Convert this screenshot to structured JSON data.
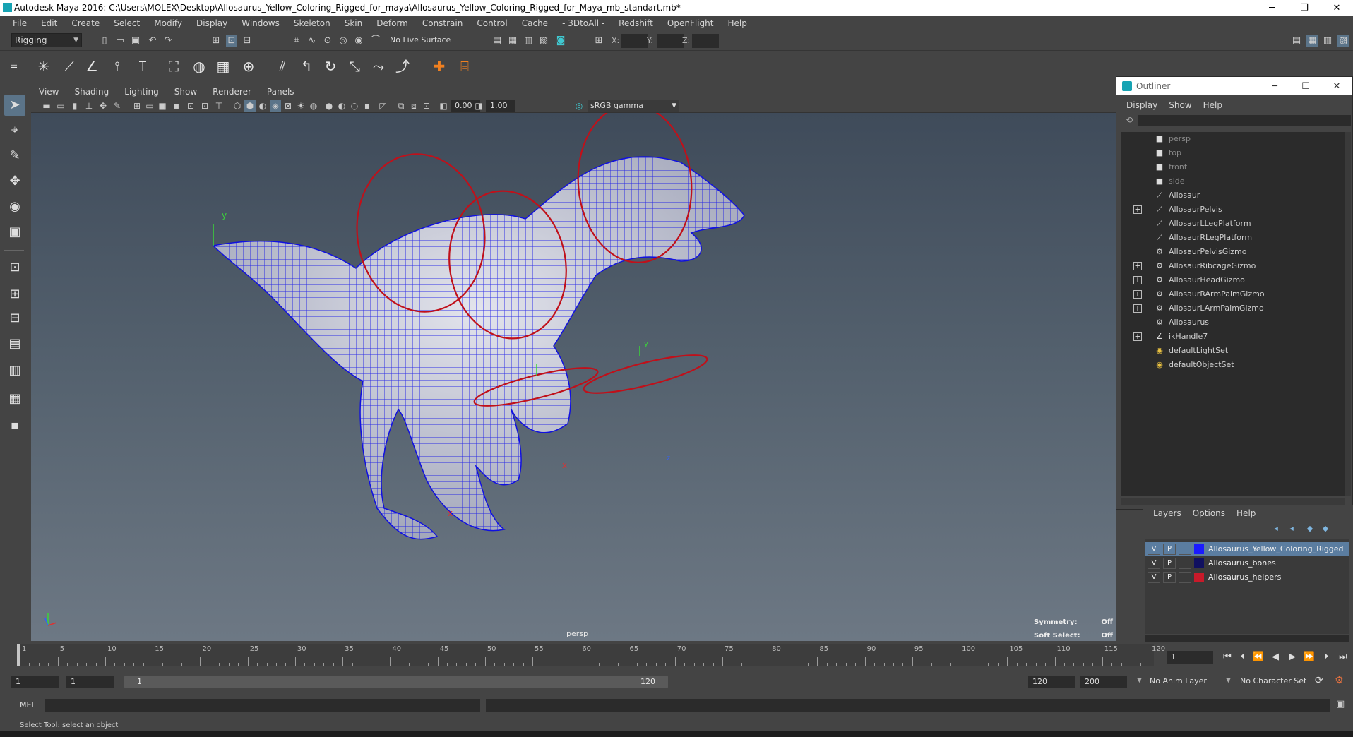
{
  "window": {
    "title": "Autodesk Maya 2016: C:\\Users\\MOLEX\\Desktop\\Allosaurus_Yellow_Coloring_Rigged_for_maya\\Allosaurus_Yellow_Coloring_Rigged_for_Maya_mb_standart.mb*",
    "minimize": "─",
    "restore": "❐",
    "close": "✕"
  },
  "menubar": [
    "File",
    "Edit",
    "Create",
    "Select",
    "Modify",
    "Display",
    "Windows",
    "Skeleton",
    "Skin",
    "Deform",
    "Constrain",
    "Control",
    "Cache",
    "- 3DtoAll -",
    "Redshift",
    "OpenFlight",
    "Help"
  ],
  "statusline": {
    "mode": "Rigging",
    "live_surface": "No Live Surface",
    "x_label": "X:",
    "y_label": "Y:",
    "z_label": "Z:"
  },
  "viewport": {
    "menu": [
      "View",
      "Shading",
      "Lighting",
      "Show",
      "Renderer",
      "Panels"
    ],
    "exposure": "0.00",
    "gamma_value": "1.00",
    "color_space": "sRGB gamma",
    "camera": "persp",
    "symmetry_label": "Symmetry:",
    "symmetry_value": "Off",
    "soft_select_label": "Soft Select:",
    "soft_select_value": "Off",
    "axis_y": "y",
    "axis_x": "x",
    "axis_z": "z"
  },
  "outliner": {
    "title": "Outliner",
    "menu": [
      "Display",
      "Show",
      "Help"
    ],
    "items": [
      {
        "label": "persp",
        "icon": "camera-icon",
        "expand": "",
        "dim": true
      },
      {
        "label": "top",
        "icon": "camera-icon",
        "expand": "",
        "dim": true
      },
      {
        "label": "front",
        "icon": "camera-icon",
        "expand": "",
        "dim": true
      },
      {
        "label": "side",
        "icon": "camera-icon",
        "expand": "",
        "dim": true
      },
      {
        "label": "Allosaur",
        "icon": "joint-icon",
        "expand": "",
        "dim": false
      },
      {
        "label": "AllosaurPelvis",
        "icon": "joint-icon",
        "expand": "+",
        "dim": false
      },
      {
        "label": "AllosaurLLegPlatform",
        "icon": "joint-icon",
        "expand": "",
        "dim": false
      },
      {
        "label": "AllosaurRLegPlatform",
        "icon": "joint-icon",
        "expand": "",
        "dim": false
      },
      {
        "label": "AllosaurPelvisGizmo",
        "icon": "curve-icon",
        "expand": "",
        "dim": false
      },
      {
        "label": "AllosaurRibcageGizmo",
        "icon": "curve-icon",
        "expand": "+",
        "dim": false
      },
      {
        "label": "AllosaurHeadGizmo",
        "icon": "curve-icon",
        "expand": "+",
        "dim": false
      },
      {
        "label": "AllosaurRArmPalmGizmo",
        "icon": "curve-icon",
        "expand": "+",
        "dim": false
      },
      {
        "label": "AllosaurLArmPalmGizmo",
        "icon": "curve-icon",
        "expand": "+",
        "dim": false
      },
      {
        "label": "Allosaurus",
        "icon": "curve-icon",
        "expand": "",
        "dim": false
      },
      {
        "label": "ikHandle7",
        "icon": "ik-handle-icon",
        "expand": "+",
        "dim": false
      },
      {
        "label": "defaultLightSet",
        "icon": "set-icon",
        "expand": "",
        "dim": false
      },
      {
        "label": "defaultObjectSet",
        "icon": "set-icon",
        "expand": "",
        "dim": false
      }
    ]
  },
  "layers": {
    "menu": [
      "Layers",
      "Options",
      "Help"
    ],
    "rows": [
      {
        "v": "V",
        "p": "P",
        "name": "Allosaurus_Yellow_Coloring_Rigged",
        "color": "#1a1aff",
        "selected": true
      },
      {
        "v": "V",
        "p": "P",
        "name": "Allosaurus_bones",
        "color": "#101060",
        "selected": false
      },
      {
        "v": "V",
        "p": "P",
        "name": "Allosaurus_helpers",
        "color": "#c81a2a",
        "selected": false
      }
    ]
  },
  "timeline": {
    "tick_labels": [
      "1",
      "5",
      "10",
      "15",
      "20",
      "25",
      "30",
      "35",
      "40",
      "45",
      "50",
      "55",
      "60",
      "65",
      "70",
      "75",
      "80",
      "85",
      "90",
      "95",
      "100",
      "105",
      "110",
      "115",
      "120"
    ],
    "current_frame": "1"
  },
  "range": {
    "start": "1",
    "start_inner": "1",
    "range_start_label": "1",
    "range_end_label": "120",
    "end": "120",
    "end_outer": "200",
    "anim_layer": "No Anim Layer",
    "character_set": "No Character Set"
  },
  "cmdline": {
    "label": "MEL"
  },
  "helpline": {
    "text": "Select Tool: select an object"
  },
  "colors": {
    "mesh_wire": "#1010e0",
    "control_curve": "#c0101a",
    "accent": "#17a3b3"
  }
}
